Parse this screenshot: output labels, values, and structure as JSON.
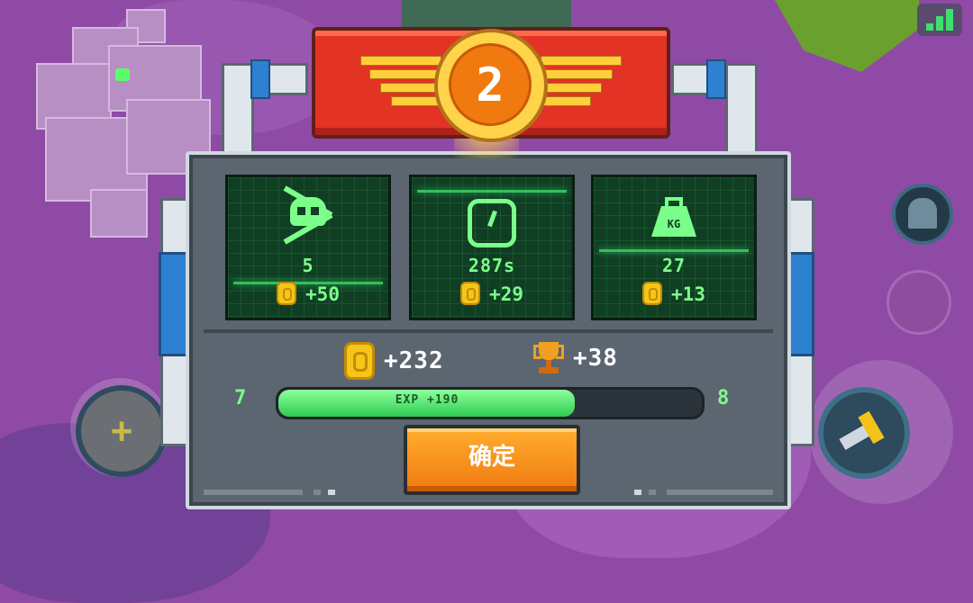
{
  "header": {
    "level_number": "2"
  },
  "stats": [
    {
      "name": "kills",
      "icon": "skull-crossbones-icon",
      "value": "5",
      "reward": "+50"
    },
    {
      "name": "time",
      "icon": "clock-icon",
      "value": "287s",
      "reward": "+29"
    },
    {
      "name": "weight",
      "icon": "kg-weight-icon",
      "icon_label": "KG",
      "value": "27",
      "reward": "+13"
    }
  ],
  "totals": {
    "coins": "+232",
    "trophies": "+38"
  },
  "experience": {
    "current_level": "7",
    "next_level": "8",
    "label": "EXP +190",
    "fill_fraction": 0.7
  },
  "confirm_label": "确定",
  "colors": {
    "background": "#8f4aa6",
    "panel": "#5b6670",
    "screen_green": "#7cff8a",
    "banner_red": "#e23325",
    "button_orange": "#f07a10",
    "coin_gold": "#f5c518"
  }
}
